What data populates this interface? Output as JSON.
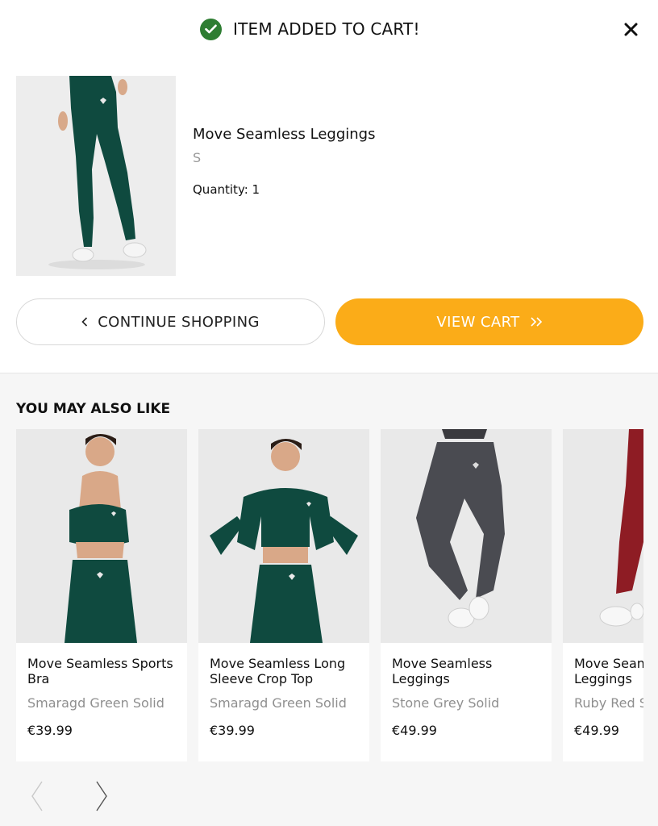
{
  "header": {
    "title": "ITEM ADDED TO CART!",
    "status_icon": "check-circle-icon",
    "status_color": "#2e7d32",
    "close_icon": "close-icon"
  },
  "added_item": {
    "name": "Move Seamless Leggings",
    "size": "S",
    "quantity_label": "Quantity: 1",
    "color": "#0f4a3f"
  },
  "actions": {
    "continue_label": "CONTINUE SHOPPING",
    "continue_icon": "chevron-left-icon",
    "view_cart_label": "VIEW CART",
    "view_cart_icon": "double-chevron-right-icon",
    "accent": "#fbac18"
  },
  "recommendations": {
    "title": "YOU MAY ALSO LIKE",
    "products": [
      {
        "name": "Move Seamless Sports Bra",
        "color": "Smaragd Green Solid",
        "price": "€39.99",
        "swatch": "#0f4a3f"
      },
      {
        "name": "Move Seamless Long Sleeve Crop Top",
        "color": "Smaragd Green Solid",
        "price": "€39.99",
        "swatch": "#0f4a3f"
      },
      {
        "name": "Move Seamless Leggings",
        "color": "Stone Grey Solid",
        "price": "€49.99",
        "swatch": "#4a4b51"
      },
      {
        "name": "Move Seamless Leggings",
        "color": "Ruby Red Solid",
        "price": "€49.99",
        "swatch": "#8e1c24"
      }
    ],
    "prev_icon": "chevron-left-icon",
    "next_icon": "chevron-right-icon"
  }
}
